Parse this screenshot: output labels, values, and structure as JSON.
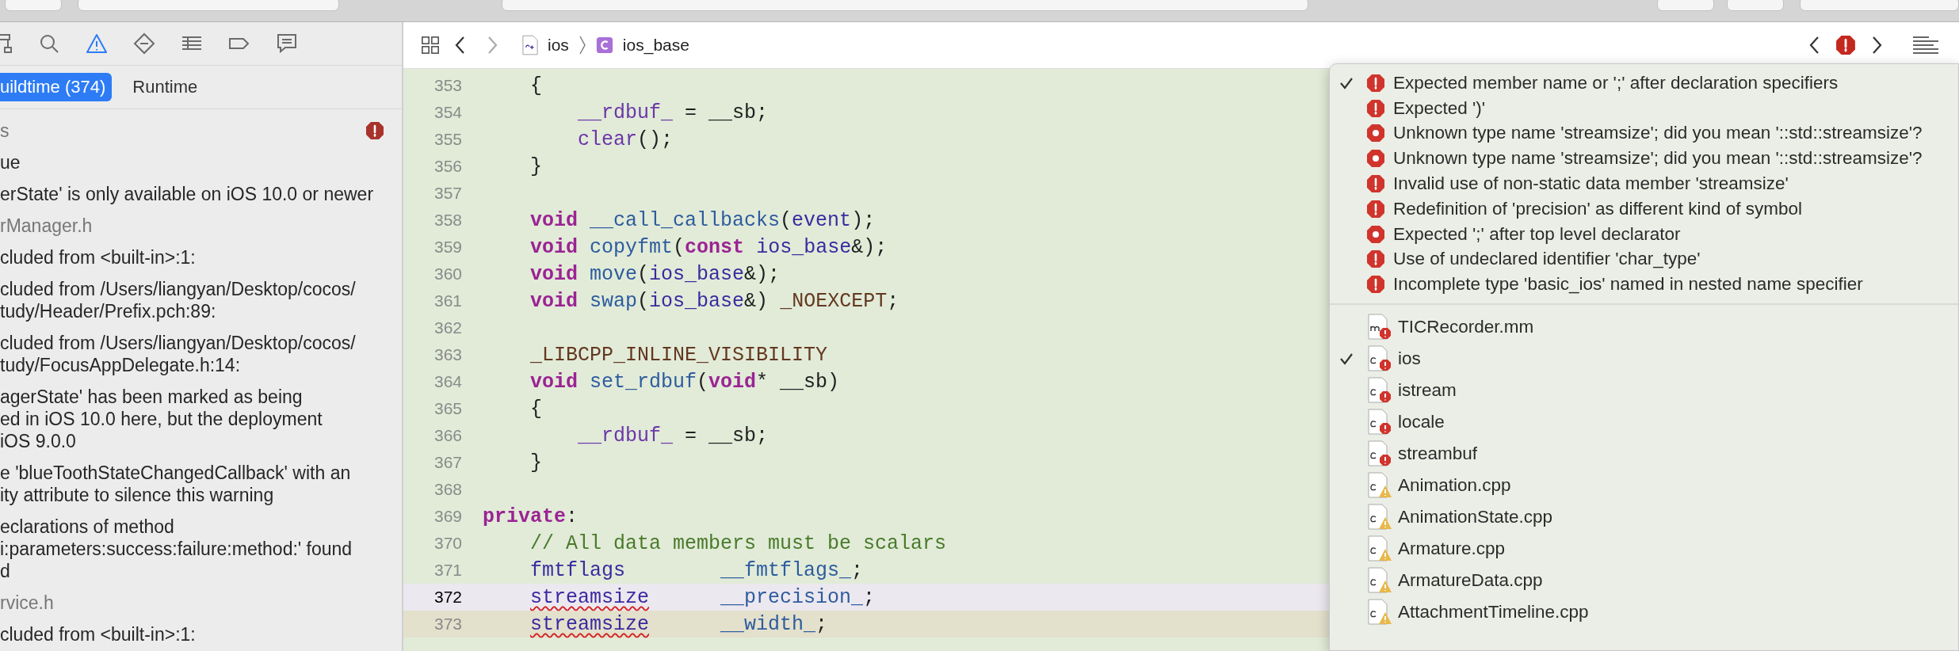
{
  "navigator_tabs": [
    {
      "kind": "hierarchy",
      "selected": false
    },
    {
      "kind": "search",
      "selected": false
    },
    {
      "kind": "warning",
      "selected": true
    },
    {
      "kind": "diamond",
      "selected": false
    },
    {
      "kind": "list",
      "selected": false
    },
    {
      "kind": "tag",
      "selected": false
    },
    {
      "kind": "comment",
      "selected": false
    }
  ],
  "issue_tabs": [
    {
      "label": "uildtime (374)",
      "selected": true
    },
    {
      "label": "Runtime",
      "selected": false
    }
  ],
  "issues": [
    {
      "kind": "group",
      "lines": [
        "s"
      ],
      "badge": true
    },
    {
      "kind": "issue",
      "lines": [
        "ue"
      ]
    },
    {
      "kind": "issue",
      "lines": [
        "erState' is only available on iOS 10.0 or newer"
      ]
    },
    {
      "kind": "file",
      "lines": [
        "rManager.h"
      ]
    },
    {
      "kind": "issue",
      "lines": [
        "cluded from <built-in>:1:"
      ]
    },
    {
      "kind": "issue",
      "lines": [
        "cluded from /Users/liangyan/Desktop/cocos/",
        "tudy/Header/Prefix.pch:89:"
      ]
    },
    {
      "kind": "issue",
      "lines": [
        "cluded from /Users/liangyan/Desktop/cocos/",
        "tudy/FocusAppDelegate.h:14:"
      ]
    },
    {
      "kind": "issue",
      "lines": [
        "agerState' has been marked as being",
        "ed in iOS 10.0 here, but the deployment",
        " iOS 9.0.0"
      ]
    },
    {
      "kind": "issue",
      "lines": [
        "e 'blueToothStateChangedCallback' with an",
        "ity attribute to silence this warning"
      ]
    },
    {
      "kind": "issue",
      "lines": [
        "eclarations of method",
        "i:parameters:success:failure:method:' found",
        "d"
      ]
    },
    {
      "kind": "file",
      "lines": [
        "rvice.h"
      ]
    },
    {
      "kind": "issue",
      "lines": [
        "cluded from <built-in>:1:"
      ]
    }
  ],
  "jump_bar": {
    "file": "ios",
    "symbol": "ios_base"
  },
  "code": [
    {
      "number": "353",
      "tokens": [
        {
          "text": "    {",
          "kind": "plain"
        }
      ]
    },
    {
      "number": "354",
      "tokens": [
        {
          "text": "        __rdbuf_",
          "kind": "var"
        },
        {
          "text": " = __sb;",
          "kind": "plain"
        }
      ]
    },
    {
      "number": "355",
      "tokens": [
        {
          "text": "        clear",
          "kind": "var"
        },
        {
          "text": "();",
          "kind": "plain"
        }
      ]
    },
    {
      "number": "356",
      "tokens": [
        {
          "text": "    }",
          "kind": "plain"
        }
      ]
    },
    {
      "number": "357"
    },
    {
      "number": "358",
      "tokens": [
        {
          "text": "    void",
          "kind": "keyword"
        },
        {
          "text": " __call_callbacks",
          "kind": "function"
        },
        {
          "text": "(",
          "kind": "plain"
        },
        {
          "text": "event",
          "kind": "type"
        },
        {
          "text": ");",
          "kind": "plain"
        }
      ]
    },
    {
      "number": "359",
      "tokens": [
        {
          "text": "    void",
          "kind": "keyword"
        },
        {
          "text": " copyfmt",
          "kind": "function"
        },
        {
          "text": "(",
          "kind": "plain"
        },
        {
          "text": "const",
          "kind": "keyword"
        },
        {
          "text": " ios_base",
          "kind": "type"
        },
        {
          "text": "&);",
          "kind": "plain"
        }
      ]
    },
    {
      "number": "360",
      "tokens": [
        {
          "text": "    void",
          "kind": "keyword"
        },
        {
          "text": " move",
          "kind": "function"
        },
        {
          "text": "(",
          "kind": "plain"
        },
        {
          "text": "ios_base",
          "kind": "type"
        },
        {
          "text": "&);",
          "kind": "plain"
        }
      ]
    },
    {
      "number": "361",
      "tokens": [
        {
          "text": "    void",
          "kind": "keyword"
        },
        {
          "text": " swap",
          "kind": "function"
        },
        {
          "text": "(",
          "kind": "plain"
        },
        {
          "text": "ios_base",
          "kind": "type"
        },
        {
          "text": "&)",
          "kind": "plain"
        },
        {
          "text": " _NOEXCEPT",
          "kind": "macro"
        },
        {
          "text": ";",
          "kind": "plain"
        }
      ]
    },
    {
      "number": "362"
    },
    {
      "number": "363",
      "tokens": [
        {
          "text": "    _LIBCPP_INLINE_VISIBILITY",
          "kind": "macro"
        }
      ]
    },
    {
      "number": "364",
      "tokens": [
        {
          "text": "    void",
          "kind": "keyword"
        },
        {
          "text": " set_rdbuf",
          "kind": "function"
        },
        {
          "text": "(",
          "kind": "plain"
        },
        {
          "text": "void",
          "kind": "keyword"
        },
        {
          "text": "* __sb)",
          "kind": "plain"
        }
      ]
    },
    {
      "number": "365",
      "tokens": [
        {
          "text": "    {",
          "kind": "plain"
        }
      ]
    },
    {
      "number": "366",
      "tokens": [
        {
          "text": "        __rdbuf_",
          "kind": "var"
        },
        {
          "text": " = __sb;",
          "kind": "plain"
        }
      ]
    },
    {
      "number": "367",
      "tokens": [
        {
          "text": "    }",
          "kind": "plain"
        }
      ]
    },
    {
      "number": "368"
    },
    {
      "number": "369",
      "tokens": [
        {
          "text": "private",
          "kind": "keyword"
        },
        {
          "text": ":",
          "kind": "plain"
        }
      ]
    },
    {
      "number": "370",
      "tokens": [
        {
          "text": "    // All data members must be scalars",
          "kind": "comment"
        }
      ]
    },
    {
      "number": "371",
      "tokens": [
        {
          "text": "    fmtflags",
          "kind": "type"
        },
        {
          "text": "        __fmtflags_",
          "kind": "function"
        },
        {
          "text": ";",
          "kind": "plain"
        }
      ]
    },
    {
      "number": "372",
      "kind": "cursor",
      "tokens": [
        {
          "text": "    streamsize",
          "kind": "error"
        },
        {
          "text": "      __precision_",
          "kind": "function"
        },
        {
          "text": ";",
          "kind": "plain"
        }
      ]
    },
    {
      "number": "373",
      "kind": "issue",
      "tokens": [
        {
          "text": "    streamsize",
          "kind": "error"
        },
        {
          "text": "      __width_",
          "kind": "function"
        },
        {
          "text": ";",
          "kind": "plain"
        }
      ]
    }
  ],
  "issue_menu": {
    "issues": [
      {
        "text": "Expected member name or ';' after declaration specifiers",
        "kind": "error",
        "selected": true
      },
      {
        "text": "Expected ')'",
        "kind": "error",
        "selected": false
      },
      {
        "text": "Unknown type name 'streamsize'; did you mean '::std::streamsize'?",
        "kind": "fixit",
        "selected": false
      },
      {
        "text": "Unknown type name 'streamsize'; did you mean '::std::streamsize'?",
        "kind": "fixit",
        "selected": false
      },
      {
        "text": "Invalid use of non-static data member 'streamsize'",
        "kind": "error",
        "selected": false
      },
      {
        "text": "Redefinition of 'precision' as different kind of symbol",
        "kind": "error",
        "selected": false
      },
      {
        "text": "Expected ';' after top level declarator",
        "kind": "fixit",
        "selected": false
      },
      {
        "text": "Use of undeclared identifier 'char_type'",
        "kind": "error",
        "selected": false
      },
      {
        "text": "Incomplete type 'basic_ios' named in nested name specifier",
        "kind": "error",
        "selected": false
      }
    ],
    "files": [
      {
        "name": "TICRecorder.mm",
        "kind": "objc",
        "selected": false
      },
      {
        "name": "ios",
        "kind": "header",
        "selected": true
      },
      {
        "name": "istream",
        "kind": "header",
        "selected": false
      },
      {
        "name": "locale",
        "kind": "header",
        "selected": false
      },
      {
        "name": "streambuf",
        "kind": "header",
        "selected": false
      },
      {
        "name": "Animation.cpp",
        "kind": "source",
        "selected": false
      },
      {
        "name": "AnimationState.cpp",
        "kind": "source",
        "selected": false
      },
      {
        "name": "Armature.cpp",
        "kind": "source",
        "selected": false
      },
      {
        "name": "ArmatureData.cpp",
        "kind": "source",
        "selected": false
      },
      {
        "name": "AttachmentTimeline.cpp",
        "kind": "source",
        "selected": false
      }
    ]
  }
}
